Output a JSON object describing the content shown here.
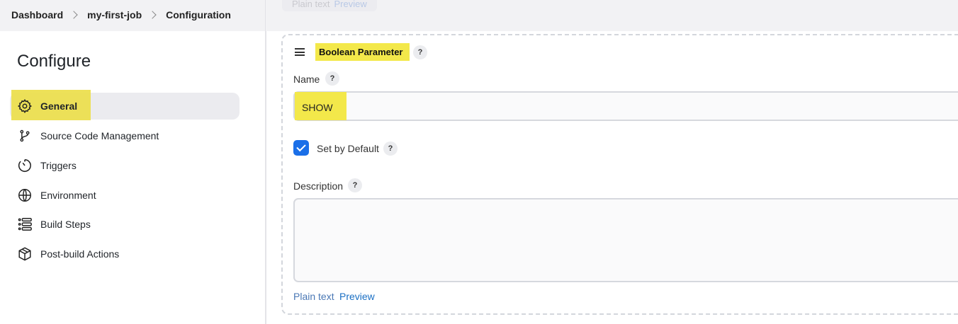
{
  "breadcrumb": {
    "items": [
      "Dashboard",
      "my-first-job",
      "Configuration"
    ]
  },
  "ghost_above": {
    "plain_text": "Plain text",
    "preview": "Preview"
  },
  "sidebar": {
    "title": "Configure",
    "items": [
      {
        "label": "General",
        "icon": "gear-icon",
        "active": true
      },
      {
        "label": "Source Code Management",
        "icon": "branch-icon",
        "active": false
      },
      {
        "label": "Triggers",
        "icon": "timer-icon",
        "active": false
      },
      {
        "label": "Environment",
        "icon": "globe-icon",
        "active": false
      },
      {
        "label": "Build Steps",
        "icon": "list-icon",
        "active": false
      },
      {
        "label": "Post-build Actions",
        "icon": "package-icon",
        "active": false
      }
    ]
  },
  "parameter": {
    "title": "Boolean Parameter",
    "help": "?",
    "name_label": "Name",
    "name_value": "SHOW",
    "set_by_default_label": "Set by Default",
    "set_by_default_checked": true,
    "description_label": "Description",
    "description_value": "",
    "plain_text_link": "Plain text",
    "preview_link": "Preview"
  },
  "colors": {
    "highlight": "#f3e84a",
    "link": "#1a6fc4",
    "checkbox": "#1a6fe8",
    "active_item_bg": "#ebebef"
  }
}
